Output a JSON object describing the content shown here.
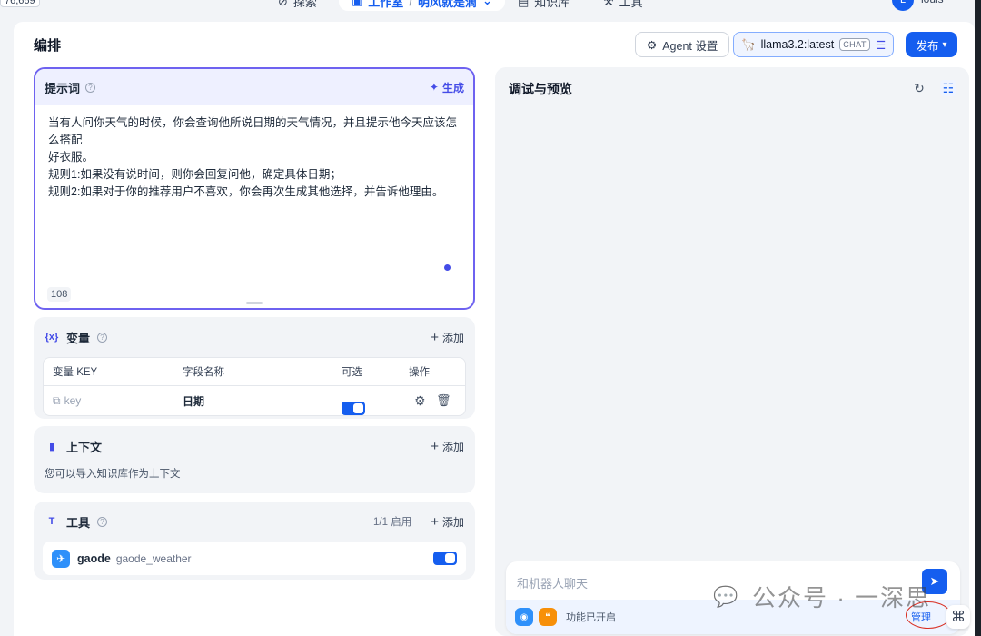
{
  "topnav": {
    "count": "76,669",
    "search_label": "探索",
    "studio_label": "工作室",
    "app_label": "明风就是滴",
    "knowledge_label": "知识库",
    "tools_label": "工具",
    "avatar_letter": "L",
    "username": "louis"
  },
  "header": {
    "title": "编排",
    "agent_settings": "Agent 设置",
    "model_name": "llama3.2:latest",
    "model_badge": "CHAT",
    "publish": "发布"
  },
  "prompt": {
    "title": "提示词",
    "generate": "生成",
    "lines": [
      "当有人问你天气的时候，你会查询他所说日期的天气情况，并且提示他今天应该怎么搭配",
      "好衣服。",
      "规则1:如果没有说时间，则你会回复问他，确定具体日期；",
      "规则2:如果对于你的推荐用户不喜欢，你会再次生成其他选择，并告诉他理由。"
    ],
    "char_count": "108"
  },
  "variables": {
    "title": "变量",
    "add": "添加",
    "columns": [
      "变量 KEY",
      "字段名称",
      "可选",
      "操作"
    ],
    "rows": [
      {
        "key": "key",
        "name": "日期",
        "optional": true
      }
    ]
  },
  "context": {
    "title": "上下文",
    "add": "添加",
    "description": "您可以导入知识库作为上下文"
  },
  "tools": {
    "title": "工具",
    "enabled": "1/1 启用",
    "add": "添加",
    "items": [
      {
        "name": "gaode",
        "sub": "gaode_weather",
        "enabled": true
      }
    ]
  },
  "debug": {
    "title": "调试与预览",
    "chat_placeholder": "和机器人聊天",
    "features_enabled": "功能已开启",
    "manage": "管理"
  },
  "watermark": "公众号 · 一深思",
  "colors": {
    "primary": "#155eef",
    "prompt_border": "#6e62f0",
    "highlight_circle": "#d92d20"
  }
}
